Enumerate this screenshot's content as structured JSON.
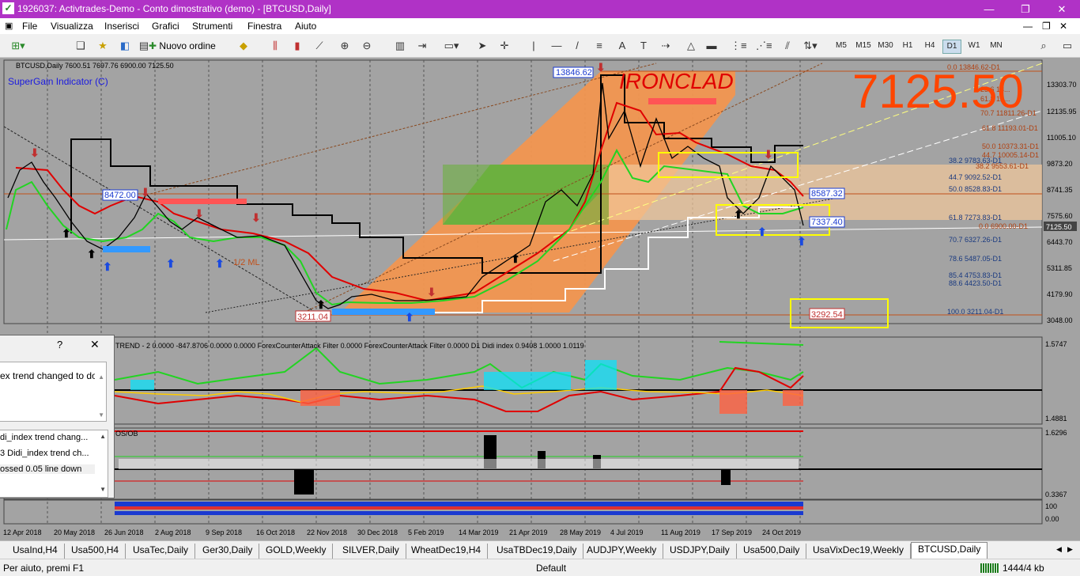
{
  "window": {
    "title": "1926037: Activtrades-Demo - Conto dimostrativo (demo) - [BTCUSD,Daily]"
  },
  "menu": [
    "File",
    "Visualizza",
    "Inserisci",
    "Grafici",
    "Strumenti",
    "Finestra",
    "Aiuto"
  ],
  "toolbar": {
    "new_order": "Nuovo ordine",
    "timeframes": [
      "M5",
      "M15",
      "M30",
      "H1",
      "H4",
      "D1",
      "W1",
      "MN"
    ],
    "active_timeframe": "D1"
  },
  "chart": {
    "header": "BTCUSD,Daily  7600.51 7697.76 6900.00 7125.50",
    "indicator_label": "SuperGain Indicator (C)",
    "big_price": "7125.50",
    "brand_text": "IRONCLAD",
    "price_labels": [
      "13846.62",
      "8472.00",
      "3211.04",
      "8587.32",
      "7337.40",
      "3292.54"
    ],
    "price_axis": [
      "13303.70",
      "12135.95",
      "11005.10",
      "9873.20",
      "8741.35",
      "7575.60",
      "6443.70",
      "5311.85",
      "4179.90",
      "3048.00"
    ],
    "current_price": "7125.50",
    "fib_levels": [
      "0.0 13846.62-D1",
      "23.6 13...",
      "61.8 12...",
      "70.7 11811.26-D1",
      "61.8 11193.01-D1",
      "50.0 10373.31-D1",
      "44.7 10005.14-D1",
      "38.2 9783.63-D1",
      "38.2 9553.61-D1",
      "44.7 9092.52-D1",
      "50.0 8528.83-D1",
      "61.8 7273.83-D1",
      "0.0 6900.00-D1",
      "70.7 6327.26-D1",
      "78.6 5487.05-D1",
      "85.4 4753.83-D1",
      "88.6 4423.50-D1",
      "100.0 3211.04-D1"
    ],
    "pitchfork_label": "1/2 ML",
    "date_axis": [
      "12 Apr 2018",
      "20 May 2018",
      "26 Jun 2018",
      "2 Aug 2018",
      "9 Sep 2018",
      "16 Oct 2018",
      "22 Nov 2018",
      "30 Dec 2018",
      "5 Feb 2019",
      "14 Mar 2019",
      "21 Apr 2019",
      "28 May 2019",
      "4 Jul 2019",
      "11 Aug 2019",
      "17 Sep 2019",
      "24 Oct 2019"
    ],
    "subwindow1": {
      "label": "TREND - 2 0.0000 -847.8706 0.0000 0.0000  ForexCounterAttack Filter 0.0000  ForexCounterAttack Filter 0.0000  D1 Didi index 0.9408 1.0000 1.0119",
      "axis": [
        "1.5747",
        "1.4881"
      ]
    },
    "subwindow2": {
      "label": "OS/OB",
      "axis": [
        "1.6296",
        "0.3367"
      ]
    },
    "subwindow3": {
      "axis": [
        "100",
        "0.00"
      ]
    }
  },
  "alert_window": {
    "help": "?",
    "close": "✕",
    "message": "ex trend changed to dow",
    "list": [
      "di_index trend chang...",
      "3 Didi_index trend ch...",
      "ossed 0.05 line down"
    ]
  },
  "tabs": [
    "UsaInd,H4",
    "Usa500,H4",
    "UsaTec,Daily",
    "Ger30,Daily",
    "GOLD,Weekly",
    "SILVER,Daily",
    "WheatDec19,H4",
    "UsaTBDec19,Daily",
    "AUDJPY,Weekly",
    "USDJPY,Daily",
    "Usa500,Daily",
    "UsaVixDec19,Weekly",
    "BTCUSD,Daily"
  ],
  "active_tab": "BTCUSD,Daily",
  "status": {
    "help": "Per aiuto, premi F1",
    "profile": "Default",
    "traffic": "1444/4 kb"
  },
  "colors": {
    "title_bg": "#b032c6",
    "chart_bg": "#a3a3a3",
    "big_price": "#ff4500",
    "fib_box": "#f29650",
    "green_box": "#6db040",
    "yellow_box": "#ffff00"
  }
}
